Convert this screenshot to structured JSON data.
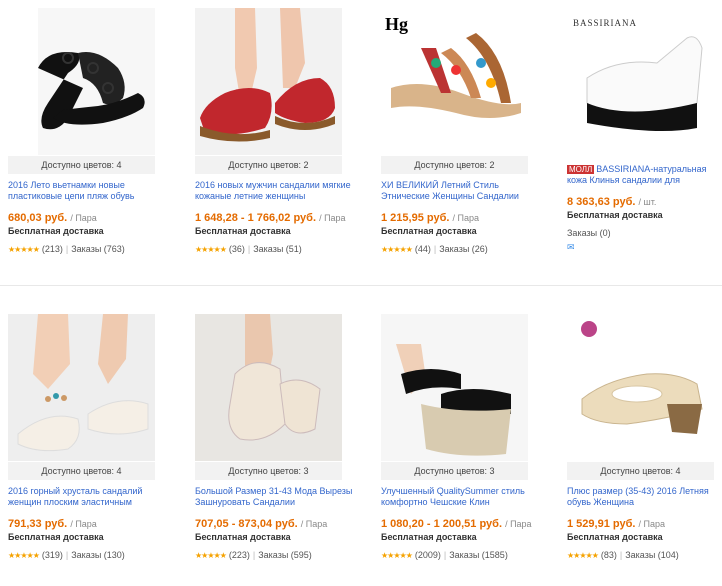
{
  "products": [
    {
      "colors": "Доступно цветов: 4",
      "title": "2016 Лето вьетнамки новые пластиковые цепи пляж обувь",
      "price": "680,03 руб.",
      "unit": "/ Пара",
      "shipping": "Бесплатная доставка",
      "reviews": "(213)",
      "orders": "Заказы (763)"
    },
    {
      "colors": "Доступно цветов: 2",
      "title": "2016 новых мужчин сандалии мягкие кожаные летние женщины",
      "price": "1 648,28 - 1 766,02 руб.",
      "unit": "/ Пара",
      "shipping": "Бесплатная доставка",
      "reviews": "(36)",
      "orders": "Заказы (51)"
    },
    {
      "colors": "Доступно цветов: 2",
      "title": "ХИ ВЕЛИКИЙ Летний Стиль Этнические Женщины Сандалии",
      "price": "1 215,95 руб.",
      "unit": "/ Пара",
      "shipping": "Бесплатная доставка",
      "reviews": "(44)",
      "orders": "Заказы (26)"
    },
    {
      "colors": "",
      "mall": "МОЛЛ",
      "title": "BASSIRIANA-натуральная кожа Клинья сандалии для",
      "price": "8 363,63 руб.",
      "unit": "/ шт.",
      "shipping": "Бесплатная доставка",
      "reviews": "",
      "orders": "Заказы (0)",
      "brand": "BASSIRIANA"
    },
    {
      "colors": "Доступно цветов: 4",
      "title": "2016 горный хрусталь сандалий женщин плоским эластичным",
      "price": "791,33 руб.",
      "unit": "/ Пара",
      "shipping": "Бесплатная доставка",
      "reviews": "(319)",
      "orders": "Заказы (130)"
    },
    {
      "colors": "Доступно цветов: 3",
      "title": "Большой Размер 31-43 Мода Вырезы Зашнуровать Сандалии",
      "price": "707,05 - 873,04 руб.",
      "unit": "/ Пара",
      "shipping": "Бесплатная доставка",
      "reviews": "(223)",
      "orders": "Заказы (595)"
    },
    {
      "colors": "Доступно цветов: 3",
      "title": "Улучшенный QualitySummer стиль комфортно Чешские Клин",
      "price": "1 080,20 - 1 200,51 руб.",
      "unit": "/ Пара",
      "shipping": "Бесплатная доставка",
      "reviews": "(2009)",
      "orders": "Заказы (1585)"
    },
    {
      "colors": "Доступно цветов: 4",
      "title": "Плюс размер (35-43) 2016 Летняя обувь Женщина",
      "price": "1 529,91 руб.",
      "unit": "/ Пара",
      "shipping": "Бесплатная доставка",
      "reviews": "(83)",
      "orders": "Заказы (104)"
    }
  ],
  "stars_glyph": "★★★★★",
  "brand_logo_text": "Hg",
  "accent": "#e46b00",
  "link": "#3366cc"
}
